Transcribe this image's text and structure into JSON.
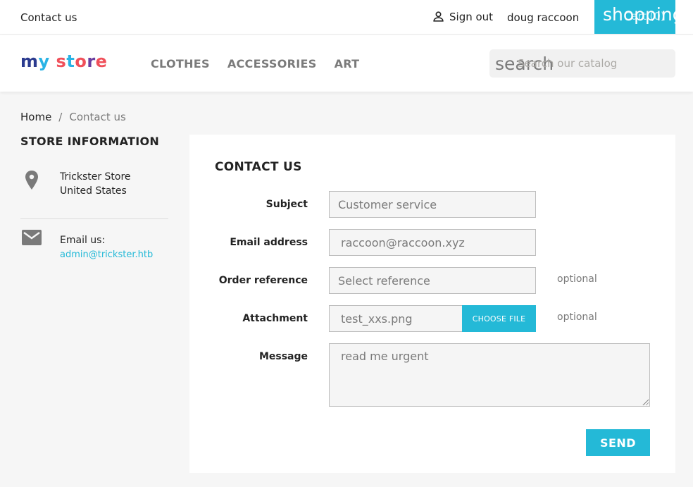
{
  "topbar": {
    "contact_link": "Contact us",
    "sign_out": "Sign out",
    "user_name": "doug raccoon",
    "cart_icon_text": "shopping_cart",
    "cart_label": "Cart (0)"
  },
  "header": {
    "logo": {
      "m": "m",
      "y": "y",
      "s": "s",
      "t": "t",
      "o": "o",
      "r": "r",
      "e": "e"
    },
    "menu": [
      {
        "label": "CLOTHES"
      },
      {
        "label": "ACCESSORIES"
      },
      {
        "label": "ART"
      }
    ],
    "search": {
      "icon_text": "search",
      "placeholder": "Search our catalog",
      "value": ""
    }
  },
  "breadcrumb": {
    "home": "Home",
    "separator": "/",
    "current": "Contact us"
  },
  "store_info": {
    "title": "STORE INFORMATION",
    "address_line1": "Trickster Store",
    "address_line2": "United States",
    "email_label": "Email us:",
    "email": "admin@trickster.htb"
  },
  "contact_form": {
    "title": "CONTACT US",
    "subject": {
      "label": "Subject",
      "value": "Customer service"
    },
    "email": {
      "label": "Email address",
      "value": "raccoon@raccoon.xyz"
    },
    "order_reference": {
      "label": "Order reference",
      "value": "Select reference",
      "hint": "optional"
    },
    "attachment": {
      "label": "Attachment",
      "file_name": "test_xxs.png",
      "button": "CHOOSE FILE",
      "hint": "optional"
    },
    "message": {
      "label": "Message",
      "value": "read me urgent"
    },
    "send_button": "SEND"
  },
  "colors": {
    "accent": "#24b9d7",
    "text": "#232323",
    "muted": "#7a7a7a",
    "background": "#f6f6f6"
  }
}
